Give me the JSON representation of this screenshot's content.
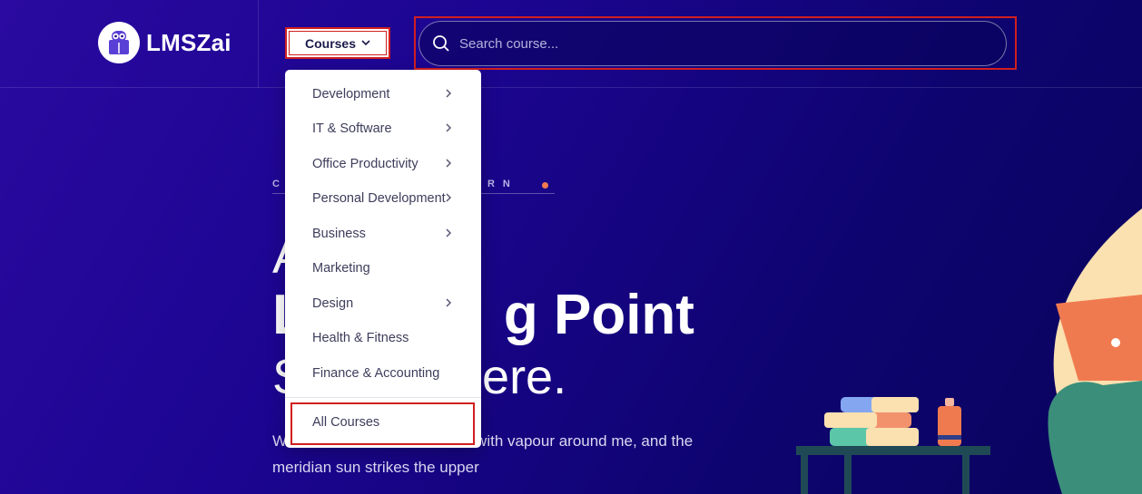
{
  "brand": {
    "name": "LMSZai"
  },
  "nav": {
    "courses_label": "Courses"
  },
  "search": {
    "placeholder": "Search course..."
  },
  "dropdown": {
    "items": [
      {
        "label": "Development",
        "has_submenu": true
      },
      {
        "label": "IT & Software",
        "has_submenu": true
      },
      {
        "label": "Office Productivity",
        "has_submenu": true
      },
      {
        "label": "Personal Development",
        "has_submenu": true
      },
      {
        "label": "Business",
        "has_submenu": true
      },
      {
        "label": "Marketing",
        "has_submenu": false
      },
      {
        "label": "Design",
        "has_submenu": true
      },
      {
        "label": "Health & Fitness",
        "has_submenu": false
      },
      {
        "label": "Finance & Accounting",
        "has_submenu": false
      }
    ],
    "all_courses_label": "All Courses"
  },
  "hero": {
    "eyebrow_start": "C",
    "eyebrow_end": "ARN",
    "line1": "A",
    "line2_start": "L",
    "line2_end": "g Point",
    "line3_start": "S",
    "line3_end": "ere.",
    "paragraph_start": "W",
    "paragraph_end": "with vapour around me, and the",
    "paragraph_line2": "meridian sun strikes the upper"
  },
  "colors": {
    "highlight_border": "#d11f1f",
    "accent_dot": "#f07a4f",
    "background": "#1c0591"
  }
}
